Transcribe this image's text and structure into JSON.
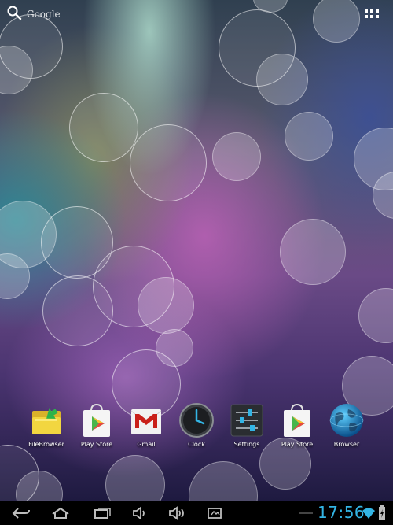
{
  "search": {
    "label": "Google",
    "icon": "search-icon"
  },
  "apps_button": {
    "icon": "all-apps-grid-icon"
  },
  "dock": {
    "apps": [
      {
        "label": "FileBrowser",
        "icon": "folder-icon"
      },
      {
        "label": "Play Store",
        "icon": "play-store-icon"
      },
      {
        "label": "Gmail",
        "icon": "gmail-icon"
      },
      {
        "label": "Clock",
        "icon": "clock-icon"
      },
      {
        "label": "Settings",
        "icon": "settings-sliders-icon"
      },
      {
        "label": "Play Store",
        "icon": "play-store-icon"
      },
      {
        "label": "Browser",
        "icon": "globe-icon"
      }
    ]
  },
  "navbar": {
    "buttons": [
      "back-icon",
      "home-icon",
      "recent-apps-icon",
      "volume-down-icon",
      "volume-up-icon",
      "screenshot-icon"
    ],
    "time": "17:56",
    "status_icons": [
      "wifi-icon",
      "battery-icon"
    ]
  },
  "colors": {
    "clock": "#33b5e5",
    "navbar": "#000000"
  }
}
